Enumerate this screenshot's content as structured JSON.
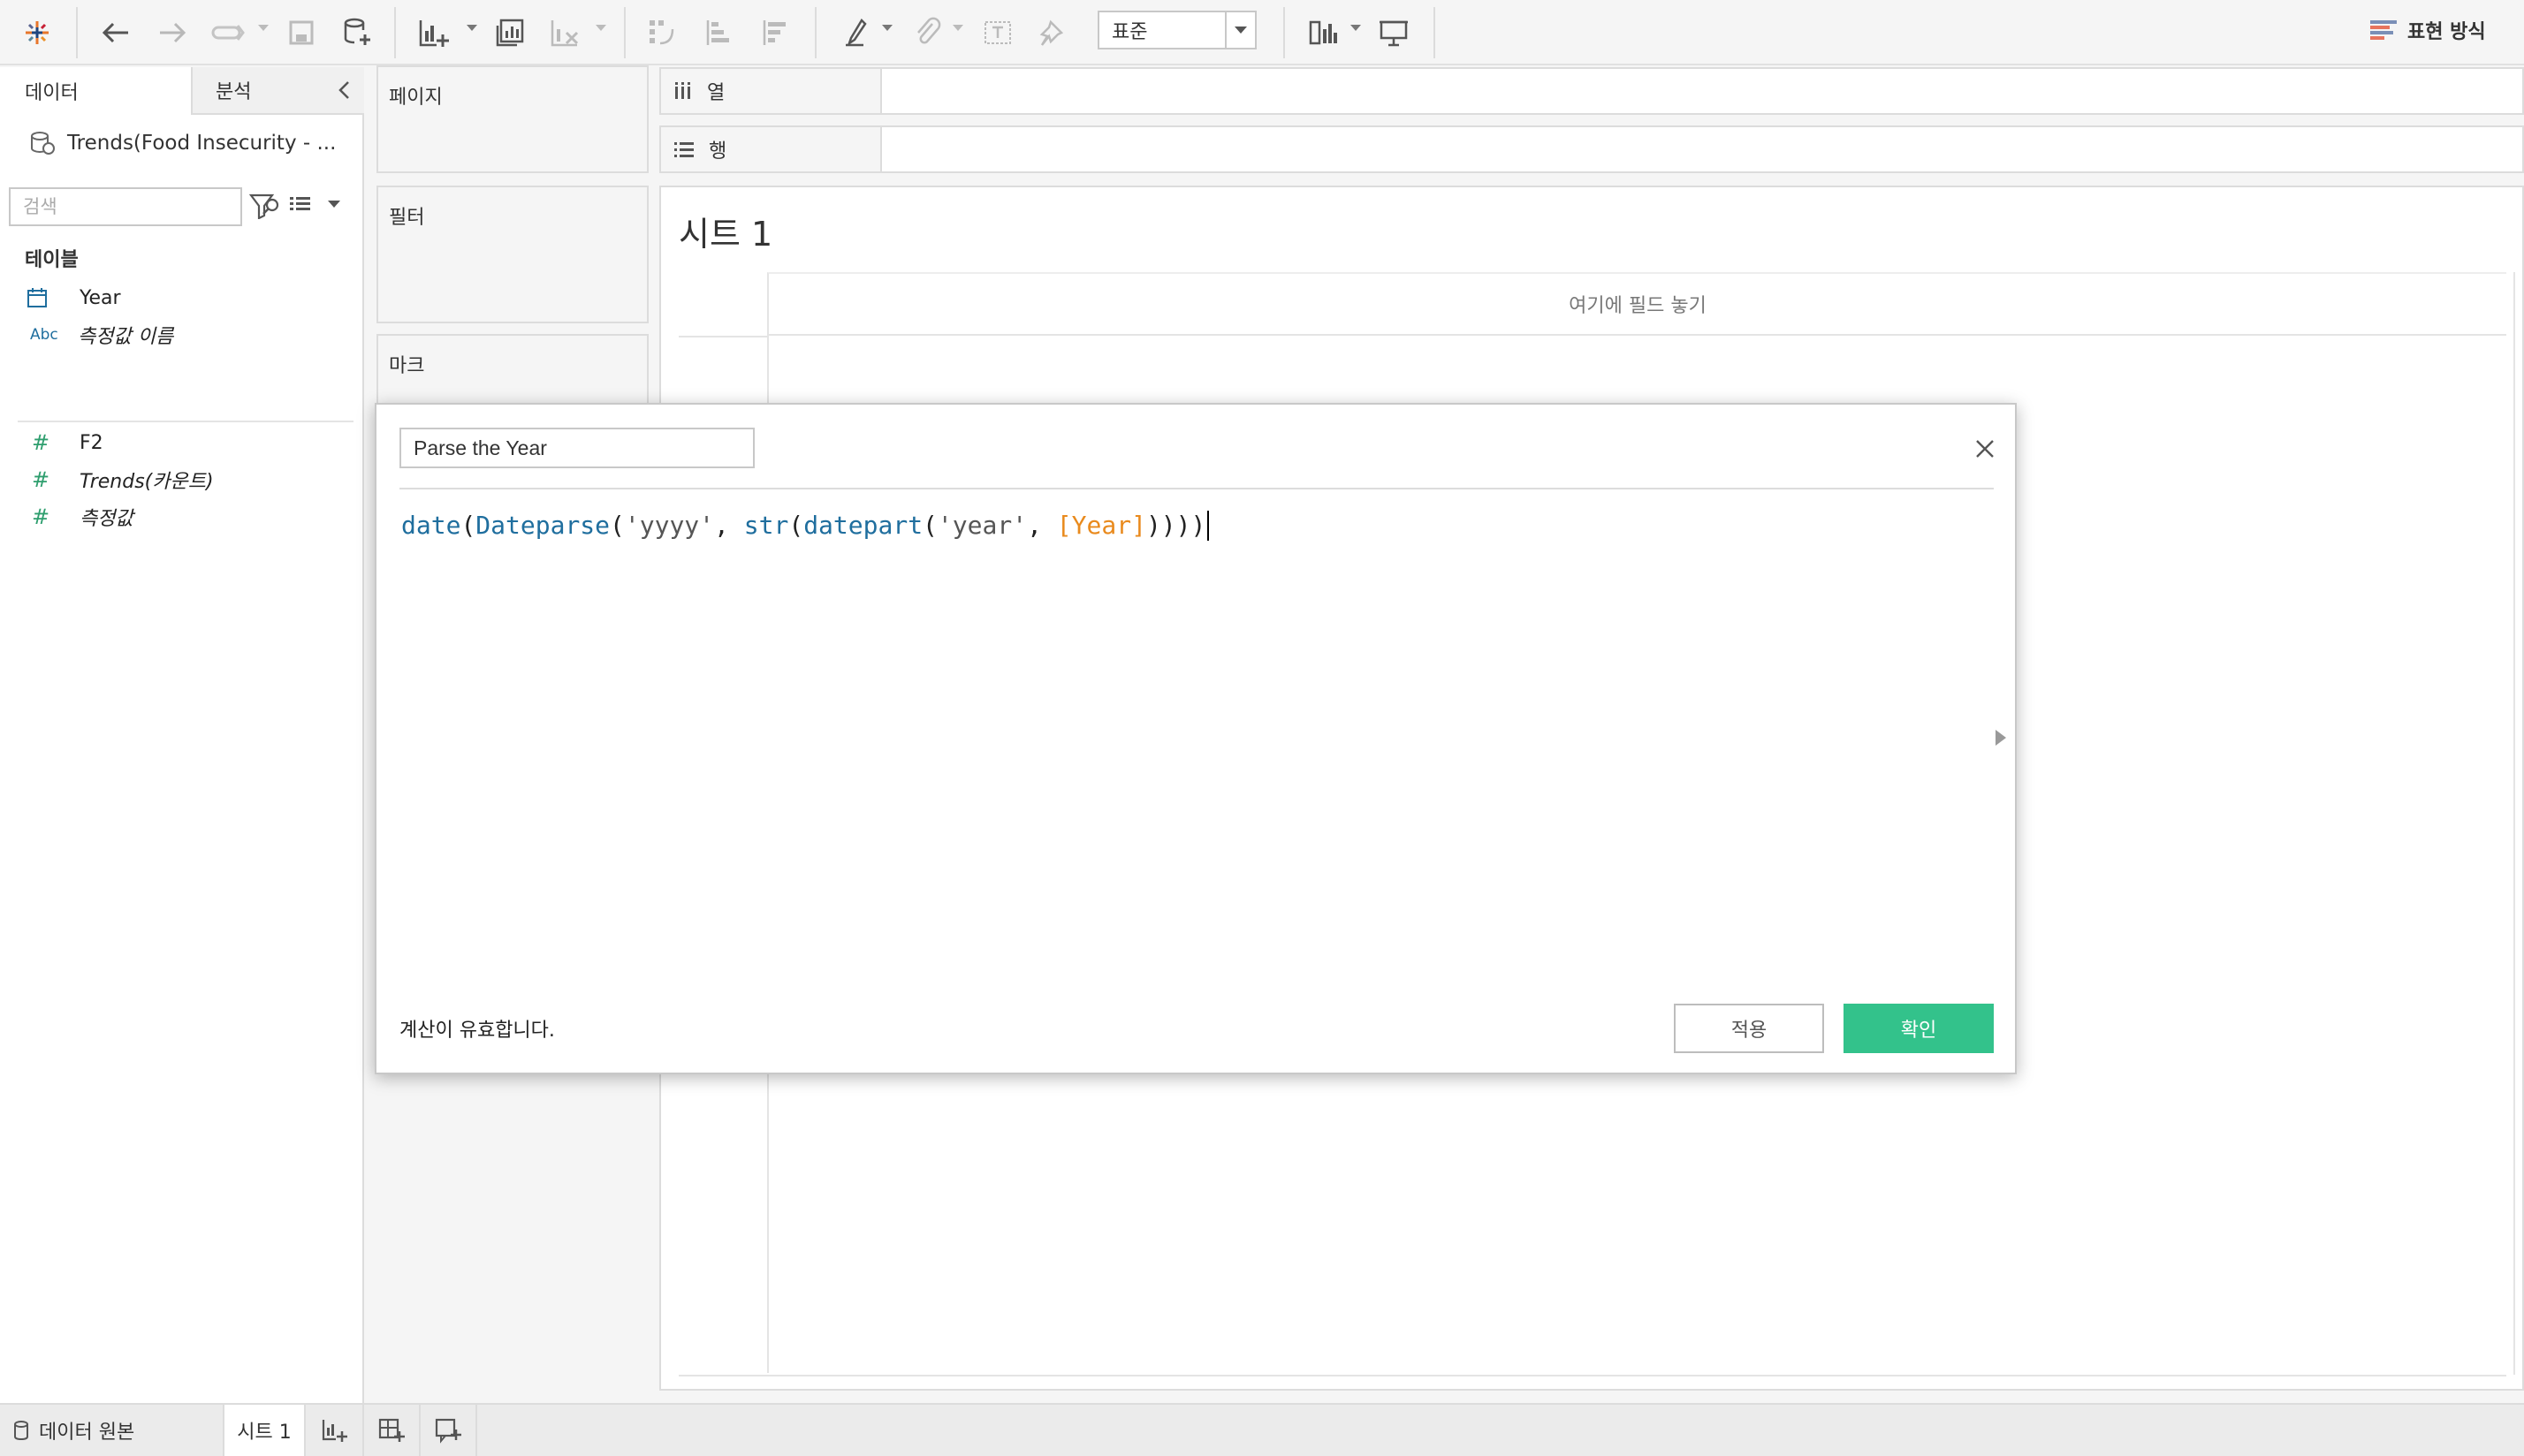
{
  "toolbar": {
    "fit_value": "표준",
    "show_me_label": "표현 방식"
  },
  "data_pane": {
    "tab_data": "데이터",
    "tab_analysis": "분석",
    "datasource_name": "Trends(Food Insecurity - ...",
    "search_placeholder": "검색",
    "tables_heading": "테이블",
    "fields": [
      {
        "type": "date",
        "type_label": "",
        "name": "Year"
      },
      {
        "type": "string",
        "type_label": "Abc",
        "name": "측정값 이름"
      },
      {
        "type": "number",
        "type_label": "#",
        "name": "F2"
      },
      {
        "type": "number",
        "type_label": "#",
        "name": "Trends(카운트)"
      },
      {
        "type": "number",
        "type_label": "#",
        "name": "측정값"
      }
    ]
  },
  "cards": {
    "pages": "페이지",
    "filters": "필터",
    "marks": "마크"
  },
  "shelves": {
    "columns": "열",
    "rows": "행"
  },
  "sheet": {
    "title": "시트 1",
    "drop_field_hint": "여기에 필드 놓기"
  },
  "calc_dialog": {
    "name": "Parse the Year",
    "formula_tokens": [
      {
        "t": "fn",
        "v": "date"
      },
      {
        "t": "punc",
        "v": "("
      },
      {
        "t": "fn",
        "v": "Dateparse"
      },
      {
        "t": "punc",
        "v": "("
      },
      {
        "t": "str",
        "v": "'yyyy'"
      },
      {
        "t": "punc",
        "v": ", "
      },
      {
        "t": "fn",
        "v": "str"
      },
      {
        "t": "punc",
        "v": "("
      },
      {
        "t": "fn",
        "v": "datepart"
      },
      {
        "t": "punc",
        "v": "("
      },
      {
        "t": "str",
        "v": "'year'"
      },
      {
        "t": "punc",
        "v": ", "
      },
      {
        "t": "field",
        "v": "[Year]"
      },
      {
        "t": "punc",
        "v": "))))"
      }
    ],
    "status": "계산이 유효합니다.",
    "apply_label": "적용",
    "ok_label": "확인"
  },
  "tabbar": {
    "datasource_tab": "데이터 원본",
    "sheet_tab": "시트 1"
  },
  "colors": {
    "ok_button": "#33c28b",
    "function_token": "#1f6e9e",
    "field_token": "#e98a1d",
    "measure_icon": "#2e9e6e",
    "dimension_icon": "#1f6e9e"
  }
}
